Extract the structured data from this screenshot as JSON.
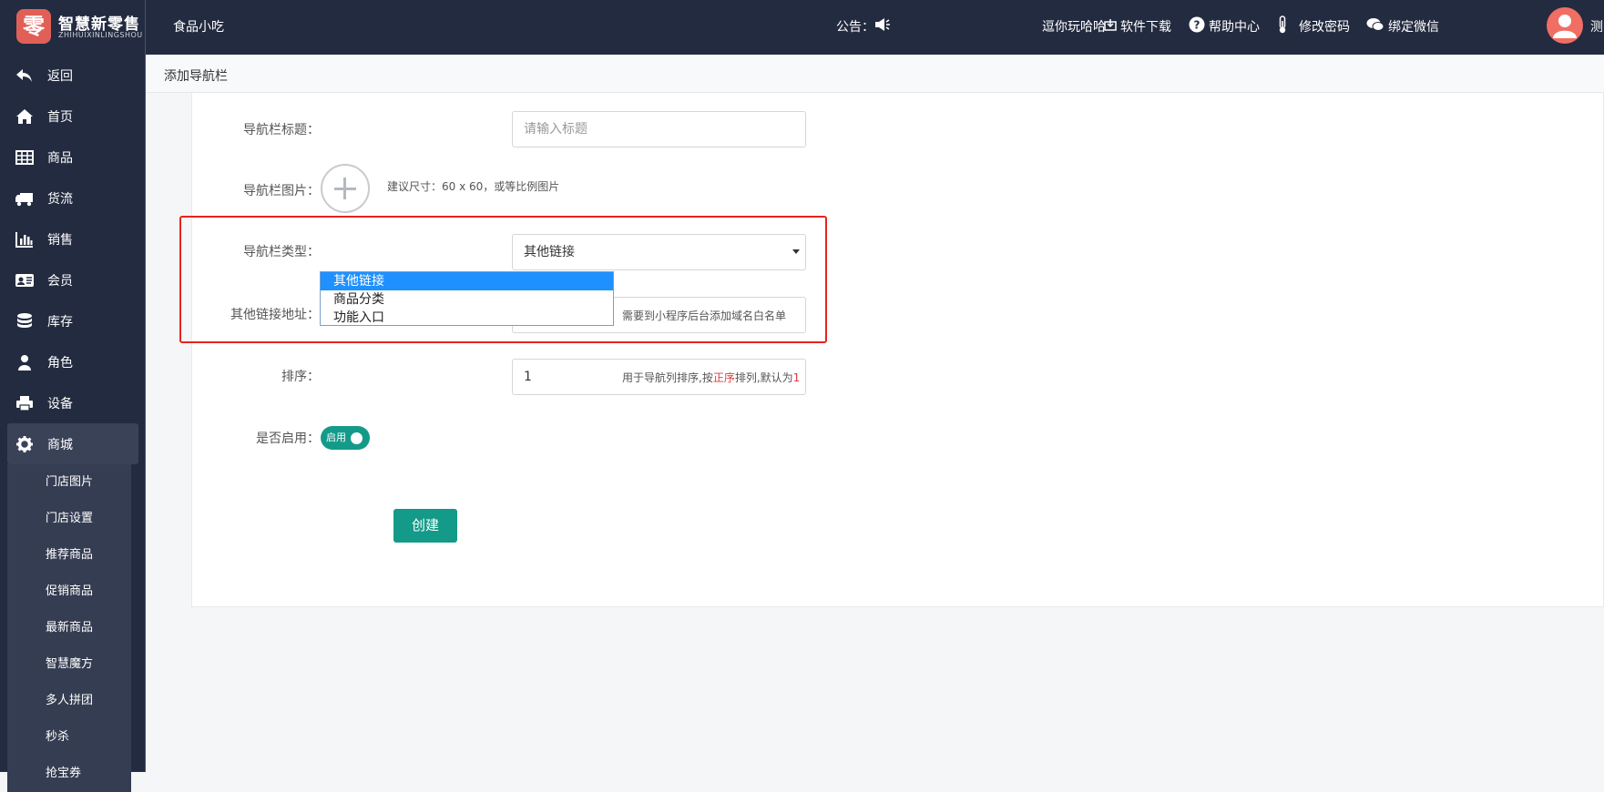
{
  "brand": {
    "mark": "零",
    "name": "智慧新零售",
    "sub": "ZHIHUIXINLINGSHOU"
  },
  "sidebar": {
    "items": [
      {
        "label": "返回",
        "icon": "undo-icon"
      },
      {
        "label": "首页",
        "icon": "home-icon"
      },
      {
        "label": "商品",
        "icon": "table-icon"
      },
      {
        "label": "货流",
        "icon": "truck-icon"
      },
      {
        "label": "销售",
        "icon": "bar-chart-icon"
      },
      {
        "label": "会员",
        "icon": "member-card-icon"
      },
      {
        "label": "库存",
        "icon": "database-icon"
      },
      {
        "label": "角色",
        "icon": "user-icon"
      },
      {
        "label": "设备",
        "icon": "printer-icon"
      },
      {
        "label": "商城",
        "icon": "gear-icon"
      }
    ],
    "sub_items": [
      "门店图片",
      "门店设置",
      "推荐商品",
      "促销商品",
      "最新商品",
      "智慧魔方",
      "多人拼团",
      "秒杀",
      "抢宝券"
    ]
  },
  "topbar": {
    "store": "食品小吃",
    "notice_label": "公告：",
    "marquee": "逗你玩哈哈",
    "download": "软件下载",
    "help": "帮助中心",
    "password": "修改密码",
    "wechat": "绑定微信",
    "user": "测"
  },
  "breadcrumb": "添加导航栏",
  "form": {
    "title_label": "导航栏标题：",
    "title_placeholder": "请输入标题",
    "image_label": "导航栏图片：",
    "image_hint": "建议尺寸：60 x 60，或等比例图片",
    "type_label": "导航栏类型：",
    "type_value": "其他链接",
    "type_options": [
      "其他链接",
      "商品分类",
      "功能入口"
    ],
    "link_label": "其他链接地址：",
    "link_hint": "需要到小程序后台添加域名白名单",
    "sort_label": "排序：",
    "sort_value": "1",
    "sort_hint_pre": "用于导航列排序,按",
    "sort_hint_em": "正序",
    "sort_hint_post": "排列,默认为",
    "sort_hint_num": "1",
    "enable_label": "是否启用：",
    "enable_value": "启用",
    "submit": "创建"
  },
  "colors": {
    "sidebar": "#232b40",
    "accent": "#149a88",
    "highlight": "#e8231f",
    "selected": "#1e90ff"
  }
}
